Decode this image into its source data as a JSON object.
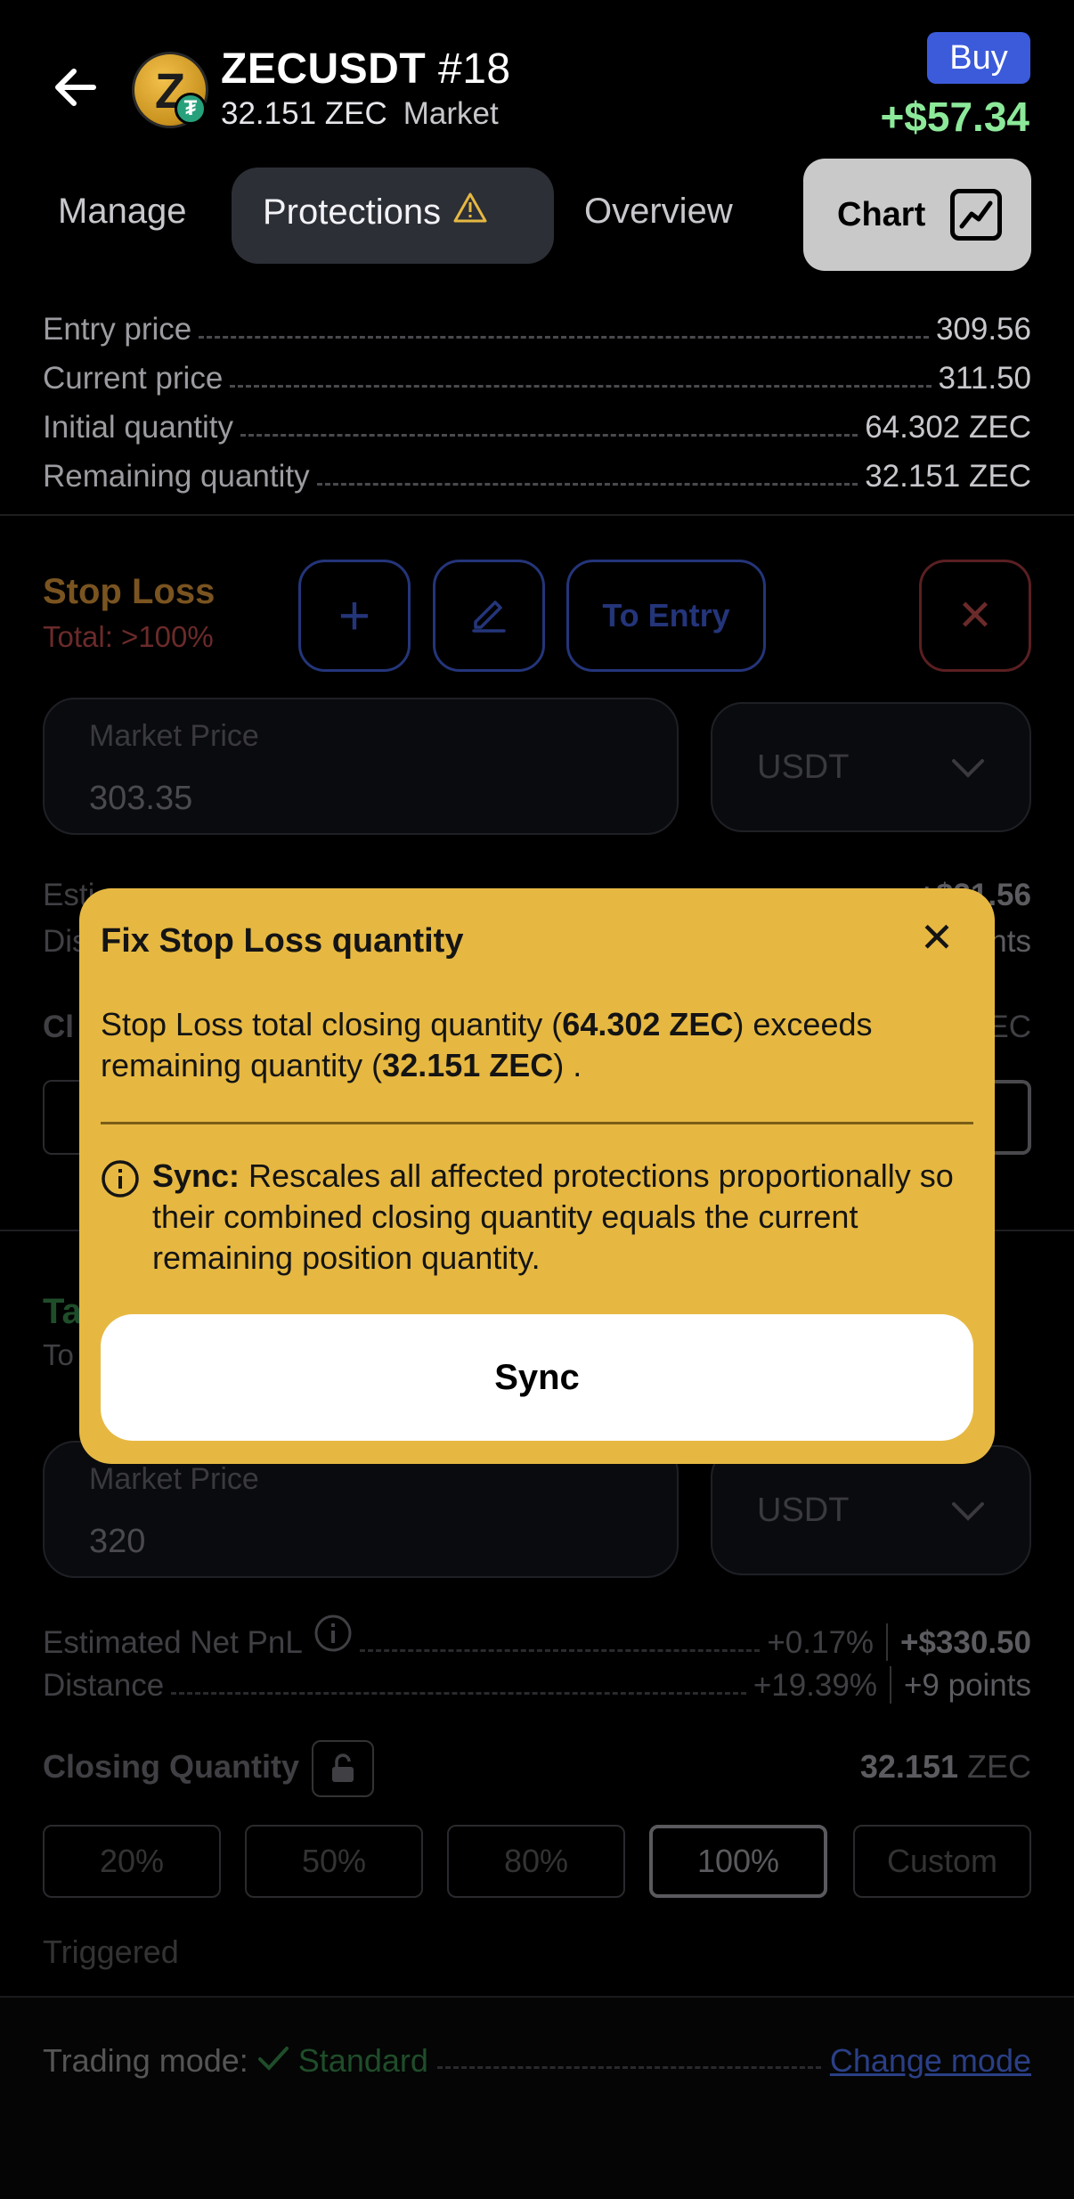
{
  "header": {
    "symbol": "ZECUSDT",
    "position_number": "#18",
    "quantity": "32.151 ZEC",
    "order_type": "Market",
    "side_badge": "Buy",
    "pnl": "+$57.34",
    "coin_letter": "Z",
    "coin_badge_letter": "₮"
  },
  "tabs": {
    "manage": "Manage",
    "protections": "Protections",
    "overview": "Overview",
    "chart": "Chart"
  },
  "info": [
    {
      "label": "Entry price",
      "value": "309.56"
    },
    {
      "label": "Current price",
      "value": "311.50"
    },
    {
      "label": "Initial quantity",
      "value": "64.302 ZEC"
    },
    {
      "label": "Remaining quantity",
      "value": "32.151 ZEC"
    }
  ],
  "stop_loss": {
    "title": "Stop Loss",
    "total": "Total: >100%",
    "to_entry": "To Entry",
    "market_price_label": "Market Price",
    "market_price_value": "303.35",
    "currency": "USDT",
    "est_pnl_value": "+$21.56",
    "distance_suffix": "nts",
    "closing_suffix": "EC",
    "est_label_partial": "Esti",
    "dist_label_partial": "Dis",
    "closing_label_partial": "Cl"
  },
  "take_profit": {
    "title_partial": "Ta",
    "total_partial": "To",
    "market_price_label": "Market Price",
    "market_price_value": "320",
    "currency": "USDT",
    "est_pnl_label": "Estimated Net PnL",
    "est_pnl_pct": "+0.17%",
    "est_pnl_value": "+$330.50",
    "distance_label": "Distance",
    "distance_pct": "+19.39%",
    "distance_points": "+9 points",
    "closing_quantity_label": "Closing Quantity",
    "closing_quantity_value": "32.151",
    "closing_quantity_unit": "ZEC",
    "percent_options": [
      "20%",
      "50%",
      "80%",
      "100%",
      "Custom"
    ],
    "selected_option": "100%",
    "triggered_label": "Triggered"
  },
  "footer": {
    "trading_mode_label": "Trading mode:",
    "trading_mode_value": "Standard",
    "change_mode": "Change mode"
  },
  "modal": {
    "title": "Fix Stop Loss quantity",
    "msg_prefix": "Stop Loss total closing quantity (",
    "msg_total": "64.302 ZEC",
    "msg_middle": ") exceeds remaining quantity (",
    "msg_remaining": "32.151 ZEC",
    "msg_suffix": ") .",
    "info_label": "Sync:",
    "info_text": " Rescales all affected protections proportionally so their combined closing quantity equals the current remaining position quantity.",
    "sync_button": "Sync"
  },
  "colors": {
    "modal_bg": "#e6b842",
    "pnl_positive": "#8ce99a",
    "buy_badge": "#3b5bdb"
  }
}
